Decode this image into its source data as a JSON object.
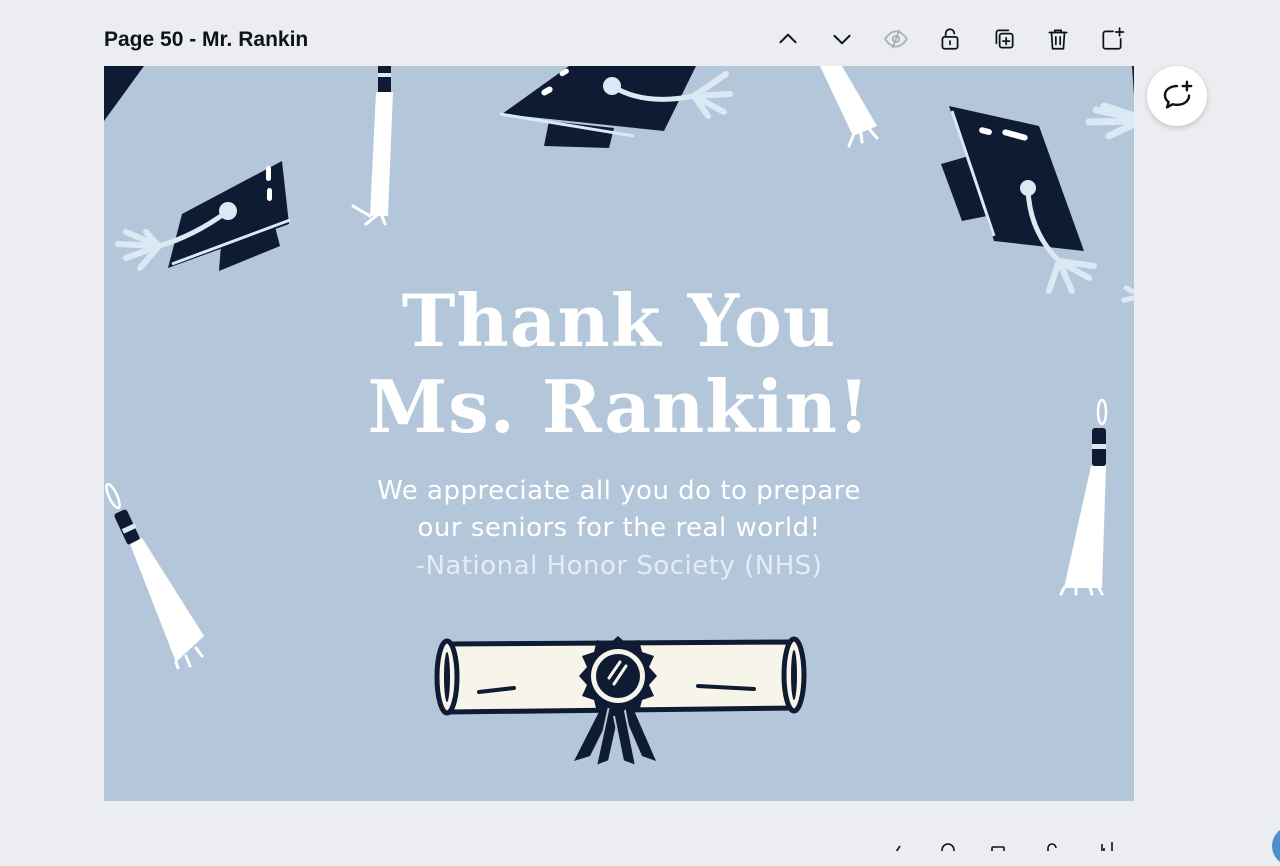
{
  "page": {
    "title": "Page 50 - Mr. Rankin"
  },
  "toolbar": {
    "icons": [
      "chevron-up-icon",
      "chevron-down-icon",
      "eye-hidden-icon",
      "unlock-icon",
      "duplicate-page-icon",
      "trash-icon",
      "add-page-icon"
    ]
  },
  "card": {
    "title_line1": "Thank You",
    "title_line2": "Ms. Rankin!",
    "message_line1": "We appreciate all you do to prepare",
    "message_line2": "our seniors for the real world!",
    "signature": "-National Honor Society (NHS)",
    "colors": {
      "background": "#b4c7da",
      "navy": "#0f1a33",
      "cream": "#f7f4ea",
      "tassel_light": "#dbe9f5"
    }
  },
  "comment": {
    "icon": "add-comment-icon"
  }
}
